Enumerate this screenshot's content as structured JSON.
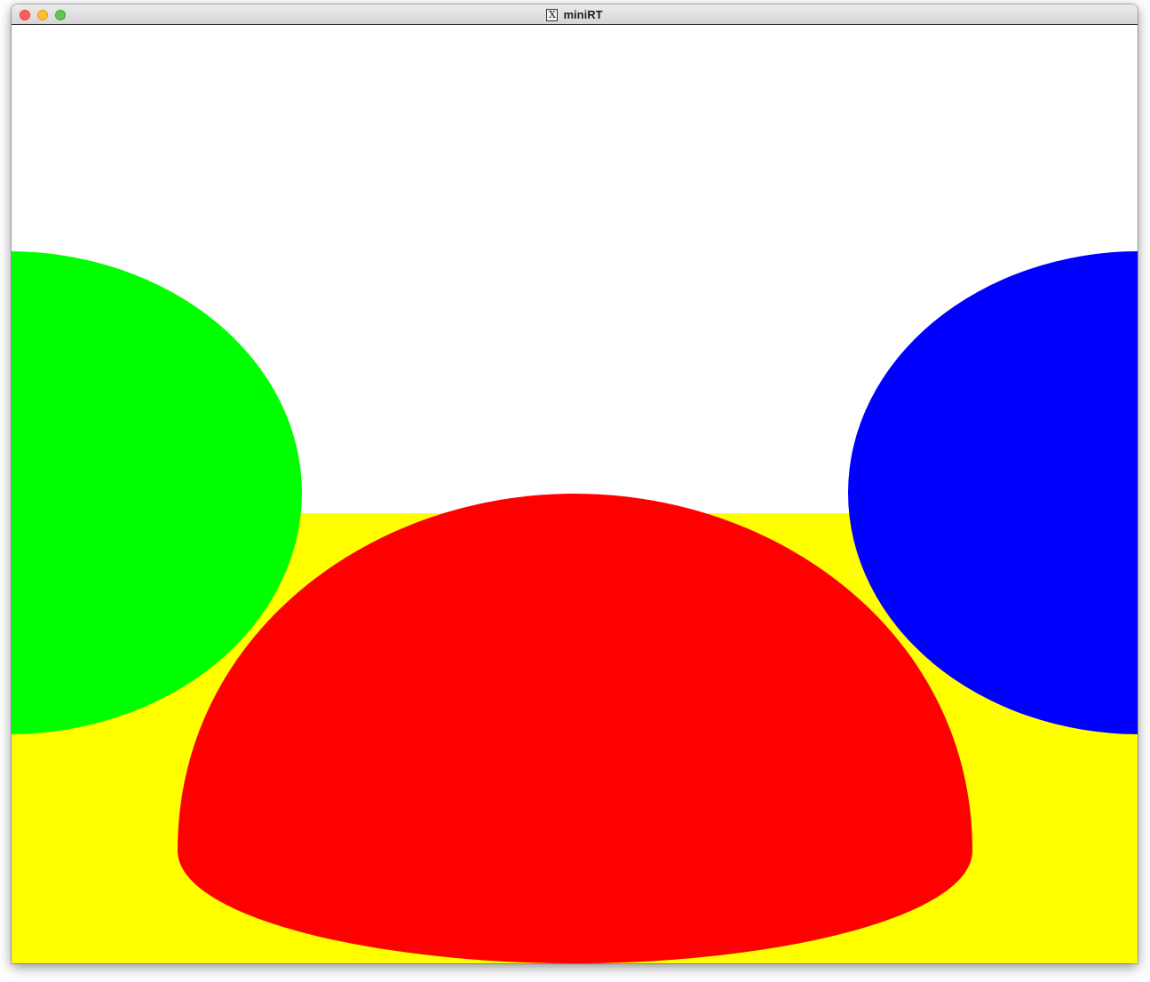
{
  "window": {
    "title": "miniRT",
    "app_icon": "x11-icon",
    "app_icon_glyph": "X"
  },
  "traffic_lights": {
    "close_color": "#fe5f57",
    "minimize_color": "#febc2e",
    "maximize_color": "#62c654"
  },
  "scene": {
    "background_color": "#ffffff",
    "plane_color": "#ffff00",
    "objects": [
      {
        "name": "green-sphere",
        "color": "#00ff00"
      },
      {
        "name": "red-sphere",
        "color": "#ff0000"
      },
      {
        "name": "blue-sphere",
        "color": "#0000ff"
      }
    ]
  }
}
